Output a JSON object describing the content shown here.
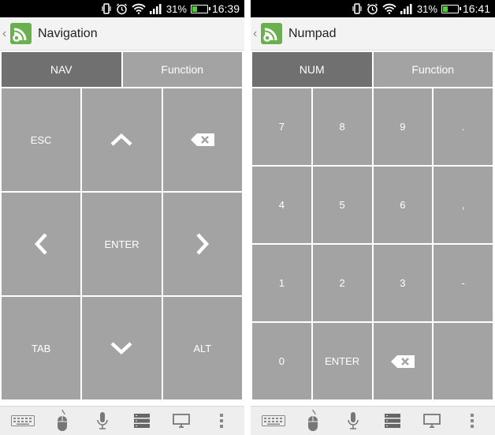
{
  "left": {
    "status": {
      "battery": "31%",
      "time": "16:39"
    },
    "title": "Navigation",
    "tabs": [
      {
        "label": "NAV",
        "active": true
      },
      {
        "label": "Function",
        "active": false
      }
    ],
    "keys": {
      "esc": "ESC",
      "enter": "ENTER",
      "tab": "TAB",
      "alt": "ALT"
    }
  },
  "right": {
    "status": {
      "battery": "31%",
      "time": "16:41"
    },
    "title": "Numpad",
    "tabs": [
      {
        "label": "NUM",
        "active": true
      },
      {
        "label": "Function",
        "active": false
      }
    ],
    "keys": {
      "k7": "7",
      "k8": "8",
      "k9": "9",
      "dot": ".",
      "k4": "4",
      "k5": "5",
      "k6": "6",
      "comma": ",",
      "k1": "1",
      "k2": "2",
      "k3": "3",
      "minus": "-",
      "k0": "0",
      "enter": "ENTER"
    }
  },
  "icons": {
    "status": [
      "vibrate-icon",
      "alarm-icon",
      "wifi-icon",
      "signal-icon",
      "battery-icon"
    ],
    "bottom": [
      "keyboard-icon",
      "mouse-icon",
      "microphone-icon",
      "list-icon",
      "monitor-icon",
      "overflow-menu-icon"
    ]
  },
  "colors": {
    "key": "#a3a3a3",
    "active_tab": "#707070",
    "accent": "#6ab04c"
  }
}
